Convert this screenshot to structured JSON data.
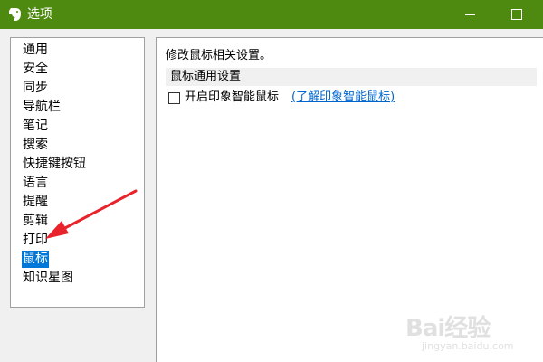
{
  "window": {
    "title": "选项",
    "icon": "evernote-elephant-icon",
    "accent_color": "#4f8a10"
  },
  "nav": {
    "items": [
      "通用",
      "安全",
      "同步",
      "导航栏",
      "笔记",
      "搜索",
      "快捷键按钮",
      "语言",
      "提醒",
      "剪辑",
      "打印",
      "鼠标",
      "知识星图"
    ],
    "selected": "鼠标",
    "selected_color": "#0078d7"
  },
  "content": {
    "description": "修改鼠标相关设置。",
    "section_title": "鼠标通用设置",
    "option": {
      "label": "开启印象智能鼠标",
      "checked": false,
      "link_text": "(了解印象智能鼠标)"
    }
  },
  "annotation": {
    "arrow_color": "#e8232b"
  },
  "watermark": {
    "text": "Bai经验",
    "subtext": "jingyan.baidu.com"
  }
}
